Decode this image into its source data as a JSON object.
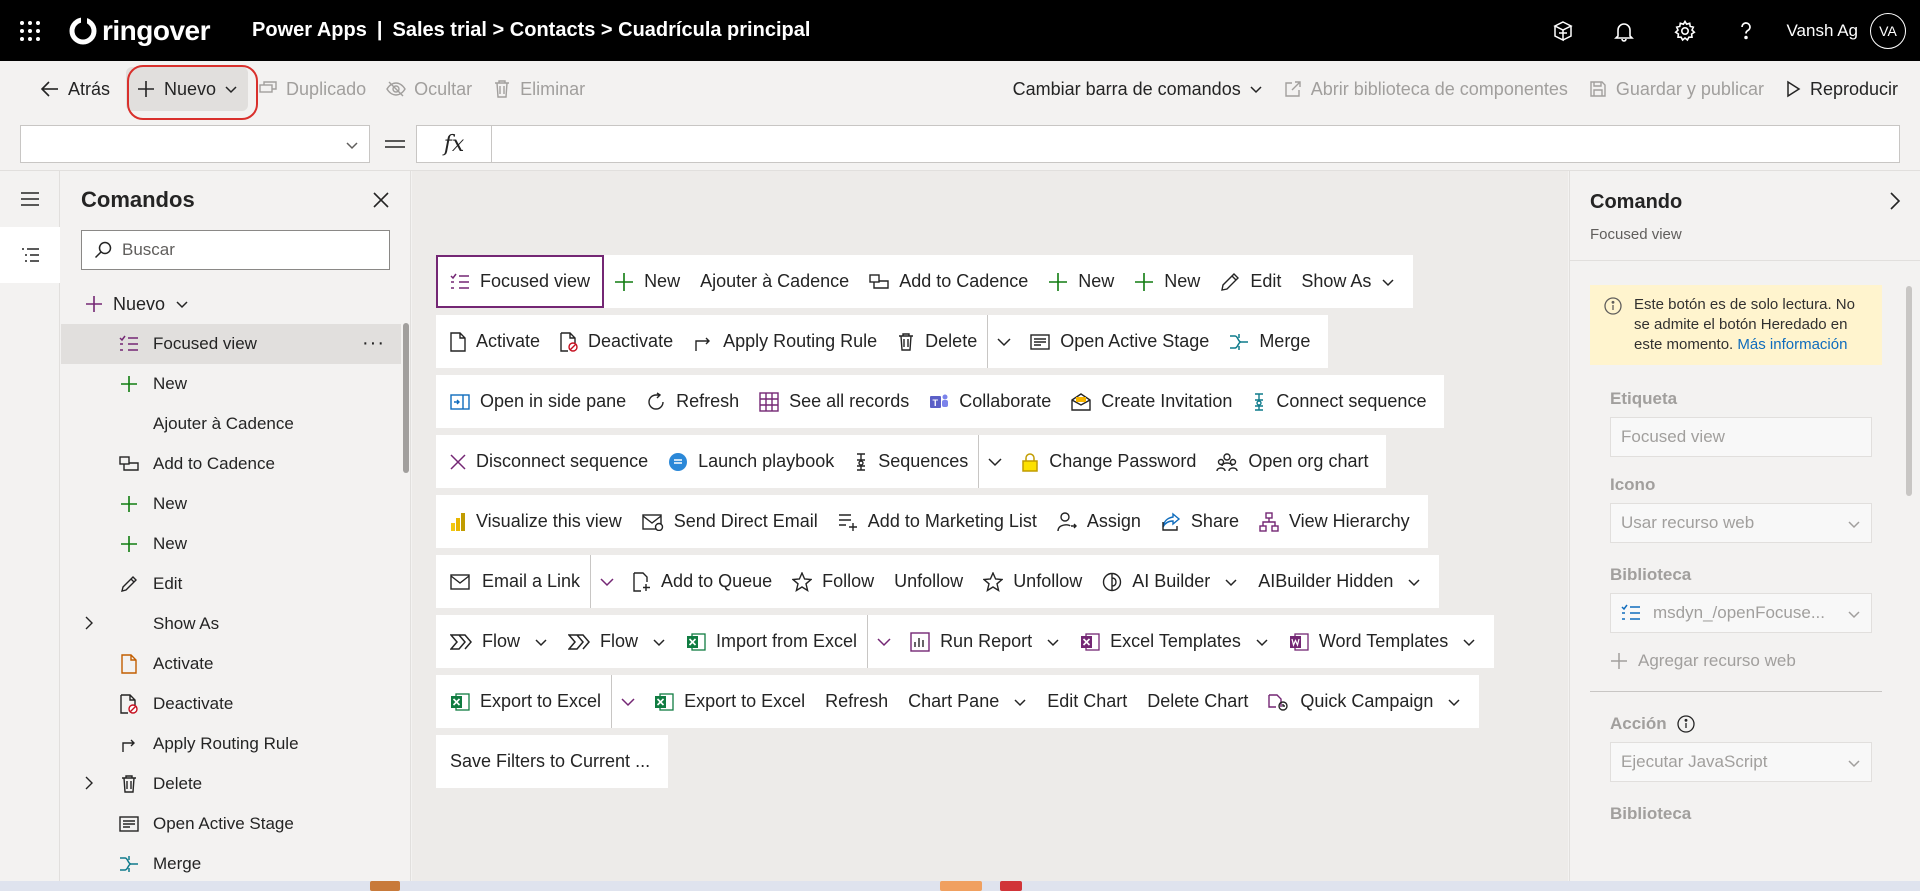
{
  "topbar": {
    "brand": "ringover",
    "app_name": "Power Apps",
    "separator": "|",
    "breadcrumb": "Sales trial > Contacts > Cuadrícula principal",
    "user_name": "Vansh Ag",
    "avatar_initials": "VA",
    "icons": [
      "waffle-icon",
      "environment-icon",
      "bell-icon",
      "gear-icon",
      "help-icon"
    ]
  },
  "commandbar": {
    "back": "Atrás",
    "new": "Nuevo",
    "duplicate": "Duplicado",
    "hide": "Ocultar",
    "delete": "Eliminar",
    "change_bar": "Cambiar barra de comandos",
    "open_library": "Abrir biblioteca de componentes",
    "save_publish": "Guardar y publicar",
    "play": "Reproducir"
  },
  "formula": {
    "fx": "fx",
    "equals": "="
  },
  "tree": {
    "title": "Comandos",
    "search_placeholder": "Buscar",
    "new_label": "Nuevo",
    "items": [
      {
        "label": "Focused view",
        "icon": "list-icon",
        "selected": true
      },
      {
        "label": "New",
        "icon": "plus-icon"
      },
      {
        "label": "Ajouter à Cadence",
        "icon": ""
      },
      {
        "label": "Add to Cadence",
        "icon": "cadence-icon"
      },
      {
        "label": "New",
        "icon": "plus-icon"
      },
      {
        "label": "New",
        "icon": "plus-icon"
      },
      {
        "label": "Edit",
        "icon": "pencil-icon"
      },
      {
        "label": "Show As",
        "icon": "",
        "expandable": true
      },
      {
        "label": "Activate",
        "icon": "document-icon"
      },
      {
        "label": "Deactivate",
        "icon": "document-deny-icon"
      },
      {
        "label": "Apply Routing Rule",
        "icon": "route-icon"
      },
      {
        "label": "Delete",
        "icon": "trash-icon",
        "expandable": true
      },
      {
        "label": "Open Active Stage",
        "icon": "stage-icon"
      },
      {
        "label": "Merge",
        "icon": "merge-icon"
      }
    ]
  },
  "canvas": {
    "rows": [
      [
        "Focused view",
        "New",
        "Ajouter à Cadence",
        "Add to Cadence",
        "New",
        "New",
        "Edit",
        "Show As"
      ],
      [
        "Activate",
        "Deactivate",
        "Apply Routing Rule",
        "Delete",
        "Open Active Stage",
        "Merge"
      ],
      [
        "Open in side pane",
        "Refresh",
        "See all records",
        "Collaborate",
        "Create Invitation",
        "Connect sequence"
      ],
      [
        "Disconnect sequence",
        "Launch playbook",
        "Sequences",
        "Change Password",
        "Open org chart"
      ],
      [
        "Visualize this view",
        "Send Direct Email",
        "Add to Marketing List",
        "Assign",
        "Share",
        "View Hierarchy"
      ],
      [
        "Email a Link",
        "Add to Queue",
        "Follow",
        "Unfollow",
        "Unfollow",
        "AI Builder",
        "AIBuilder Hidden"
      ],
      [
        "Flow",
        "Flow",
        "Import from Excel",
        "Run Report",
        "Excel Templates",
        "Word Templates"
      ],
      [
        "Export to Excel",
        "Export to Excel",
        "Refresh",
        "Chart Pane",
        "Edit Chart",
        "Delete Chart",
        "Quick Campaign"
      ],
      [
        "Save Filters to Current ..."
      ]
    ]
  },
  "panel": {
    "title": "Comando",
    "subtitle": "Focused view",
    "warning": "Este botón es de solo lectura. No se admite el botón Heredado en este momento.",
    "warning_link": "Más información",
    "label_title": "Etiqueta",
    "label_value": "Focused view",
    "icon_title": "Icono",
    "icon_value": "Usar recurso web",
    "library_title": "Biblioteca",
    "library_value": "msdyn_/openFocuse...",
    "add_resource": "Agregar recurso web",
    "action_title": "Acción",
    "action_value": "Ejecutar JavaScript",
    "library_title_2": "Biblioteca"
  },
  "colors": {
    "accent": "#742774",
    "highlight_ring": "#d9302c",
    "warning_bg": "#fff4ce",
    "plus_green": "#107c10"
  }
}
